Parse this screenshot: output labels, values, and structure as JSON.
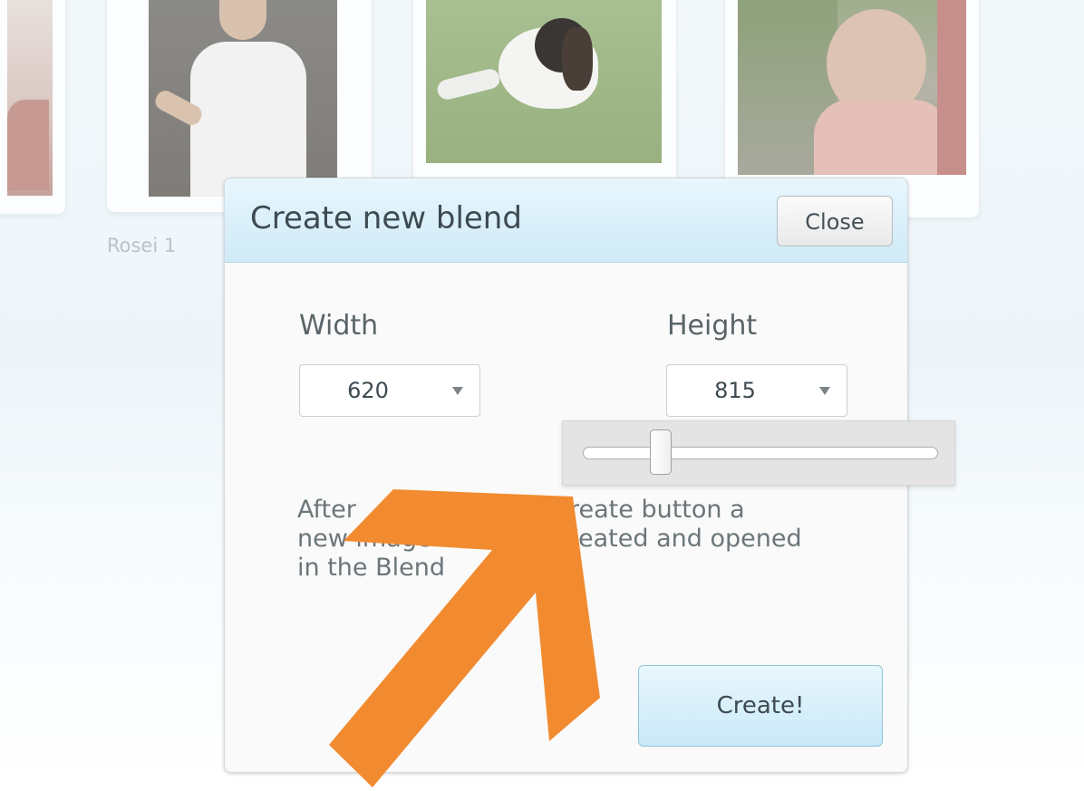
{
  "gallery": {
    "items": [
      {
        "caption": ""
      },
      {
        "caption": "Rosei 1"
      },
      {
        "caption": ""
      },
      {
        "caption": ""
      }
    ]
  },
  "dialog": {
    "title": "Create new blend",
    "close_label": "Close",
    "width_label": "Width",
    "width_value": "620",
    "height_label": "Height",
    "height_value": "815",
    "slider_fraction": 0.22,
    "help_text_lines": [
      "After",
      "reate button a",
      "new image wi",
      "eated and opened",
      "in the Blend"
    ],
    "create_label": "Create!"
  },
  "colors": {
    "accent_header": "#cfeaf7",
    "annotation_arrow": "#f28b30"
  }
}
